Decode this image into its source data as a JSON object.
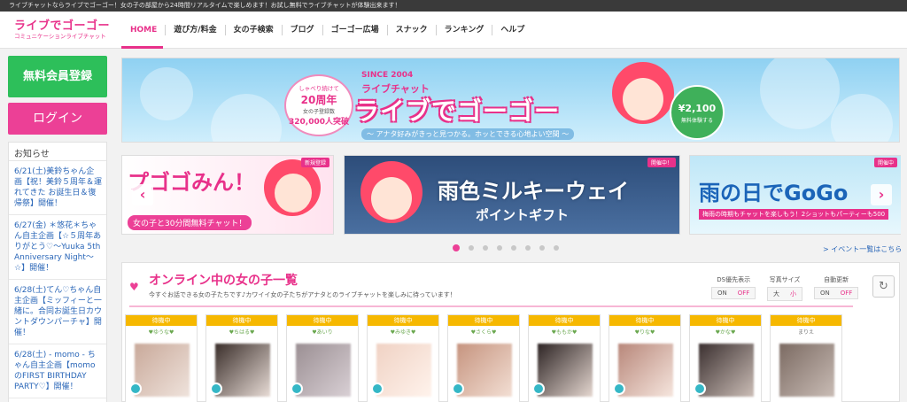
{
  "topbar": {
    "text": "ライブチャットならライブでゴーゴー！女の子の部屋から24時間リアルタイムで楽しめます！お試し無料でライブチャットが体験出来ます！"
  },
  "header": {
    "logo_main": "ライブでゴーゴー",
    "logo_sub": "コミュニケーションライブチャット",
    "nav": [
      "HOME",
      "遊び方/料金",
      "女の子検索",
      "ブログ",
      "ゴーゴー広場",
      "スナック",
      "ランキング",
      "ヘルプ"
    ]
  },
  "sidebar": {
    "register_label": "無料会員登録",
    "login_label": "ログイン",
    "news_title": "お知らせ",
    "news": [
      "6/21(土)美鈴ちゃん企画【祝！美鈴５周年＆運れてきた お誕生日＆復帰祭】開催！",
      "6/27(金) ＊悠花＊ちゃん自主企画【☆５周年ありがとう♡〜Yuuka 5th Anniversary Night〜☆】開催！",
      "6/28(土)てん♡ちゃん自主企画【ミッフィーと一緒に。合同お誕生日カウントダウンパーチャ】開催！",
      "6/28(土) - momo - ちゃん自主企画【momoのFIRST BIRTHDAY PARTY♡】開催！"
    ]
  },
  "banner": {
    "since": "SINCE 2004",
    "chat": "ライブチャット",
    "title": "ライブでゴーゴー",
    "tagline": "〜 アナタ好みがきっと見つかる。ホッとできる心地よい空間 〜",
    "badge_l1": "しゃべり続けて",
    "badge_l2": "20周年",
    "badge_l3": "女の子登録数",
    "badge_l4": "320,000人突破",
    "price": "¥2,100",
    "price_note": "無料体験する"
  },
  "carousel": {
    "slides": [
      {
        "title": "プゴゴみん！",
        "sub": "女の子と30分間無料チャット！",
        "ribbon": "新規登録"
      },
      {
        "title": "雨色ミルキーウェイ",
        "sub": "ポイントギフト",
        "ribbon": "開催中！"
      },
      {
        "title": "雨の日でGoGo",
        "sub": "梅雨の時期もチャットを楽しもう！2ショットもパーティーも500",
        "ribbon": "開催中"
      }
    ],
    "prev": "‹",
    "next": "›",
    "event_link": "> イベント一覧はこちら"
  },
  "online": {
    "heart": "♥",
    "title": "オンライン中の女の子一覧",
    "desc": "今すぐお話できる女の子たちです♪カワイイ女の子たちがアナタとのライブチャットを楽しみに待っています！",
    "controls": [
      {
        "label": "DS優先表示",
        "options": [
          "ON",
          "OFF"
        ],
        "selected": "OFF"
      },
      {
        "label": "写真サイズ",
        "options": [
          "大",
          "小"
        ],
        "selected": "小"
      },
      {
        "label": "自動更新",
        "options": [
          "ON",
          "OFF"
        ],
        "selected": "OFF"
      }
    ],
    "refresh": "↻",
    "cards": [
      {
        "status": "待機中",
        "name": "♥ゆうな♥"
      },
      {
        "status": "待機中",
        "name": "♥ちはる♥"
      },
      {
        "status": "待機中",
        "name": "♥あいり"
      },
      {
        "status": "待機中",
        "name": "♥みゆき♥"
      },
      {
        "status": "待機中",
        "name": "♥さくら♥"
      },
      {
        "status": "待機中",
        "name": "♥ももか♥"
      },
      {
        "status": "待機中",
        "name": "♥りな♥"
      },
      {
        "status": "待機中",
        "name": "♥かな♥"
      },
      {
        "status": "待機中",
        "name": "まりえ"
      }
    ]
  },
  "colors": {
    "accent": "#e8318a",
    "register": "#2dbf5a",
    "login": "#ec4096",
    "status": "#f6b800"
  }
}
